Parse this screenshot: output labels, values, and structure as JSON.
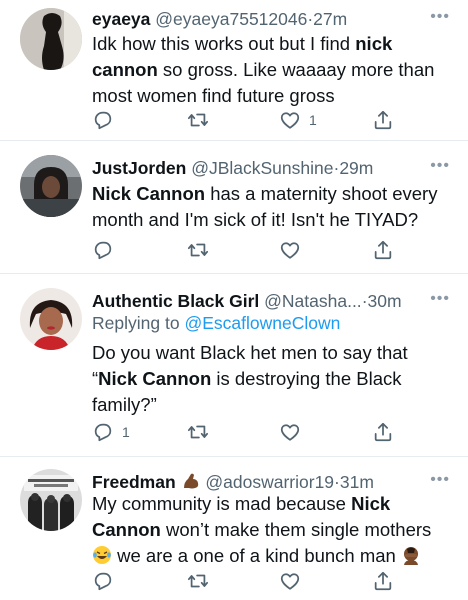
{
  "tweets": [
    {
      "name": "eyaeya",
      "handle": "@eyaeya75512046",
      "separator": "·",
      "time": "27m",
      "text_parts": [
        "Idk how this works out but I find ",
        "nick cannon",
        " so gross. Like waaaay more than most women find future gross"
      ],
      "like_count": "1",
      "reply_count": "",
      "avatar_icon": "person-photo-dark"
    },
    {
      "name": "JustJorden",
      "handle": "@JBlackSunshine",
      "separator": "·",
      "time": "29m",
      "text_parts": [
        "Nick Cannon",
        " has a maternity shoot every month and I'm sick of it! Isn't he TIYAD?"
      ],
      "avatar_icon": "person-photo-car"
    },
    {
      "name": "Authentic Black Girl",
      "handle": "@Natasha...",
      "separator": "·",
      "time": "30m",
      "reply_prefix": "Replying to",
      "reply_mention": "@EscaflowneClown",
      "text_parts": [
        "Do you want Black het men to say that “",
        "Nick Cannon",
        " is destroying the Black family?”"
      ],
      "reply_count": "1",
      "avatar_icon": "person-photo-red"
    },
    {
      "name": "Freedman",
      "handle": "@adoswarrior19",
      "separator": "·",
      "time": "31m",
      "name_emoji": "flexed-biceps-emoji",
      "text_parts": [
        "My community is mad because ",
        "Nick Cannon",
        " won’t make them single mothers",
        "we are a one of a kind bunch man"
      ],
      "avatar_icon": "historic-photo-bw",
      "emojis": [
        "laughing-tears-emoji",
        "facepalm-emoji"
      ]
    }
  ],
  "icons": {
    "more": "more-options-icon",
    "reply": "reply-icon",
    "retweet": "retweet-icon",
    "like": "like-icon",
    "share": "share-icon"
  },
  "colors": {
    "text": "#0f1419",
    "secondary": "#536471",
    "link": "#1d9bf0",
    "divider": "#e6ecf0"
  },
  "more_glyph": "•••"
}
